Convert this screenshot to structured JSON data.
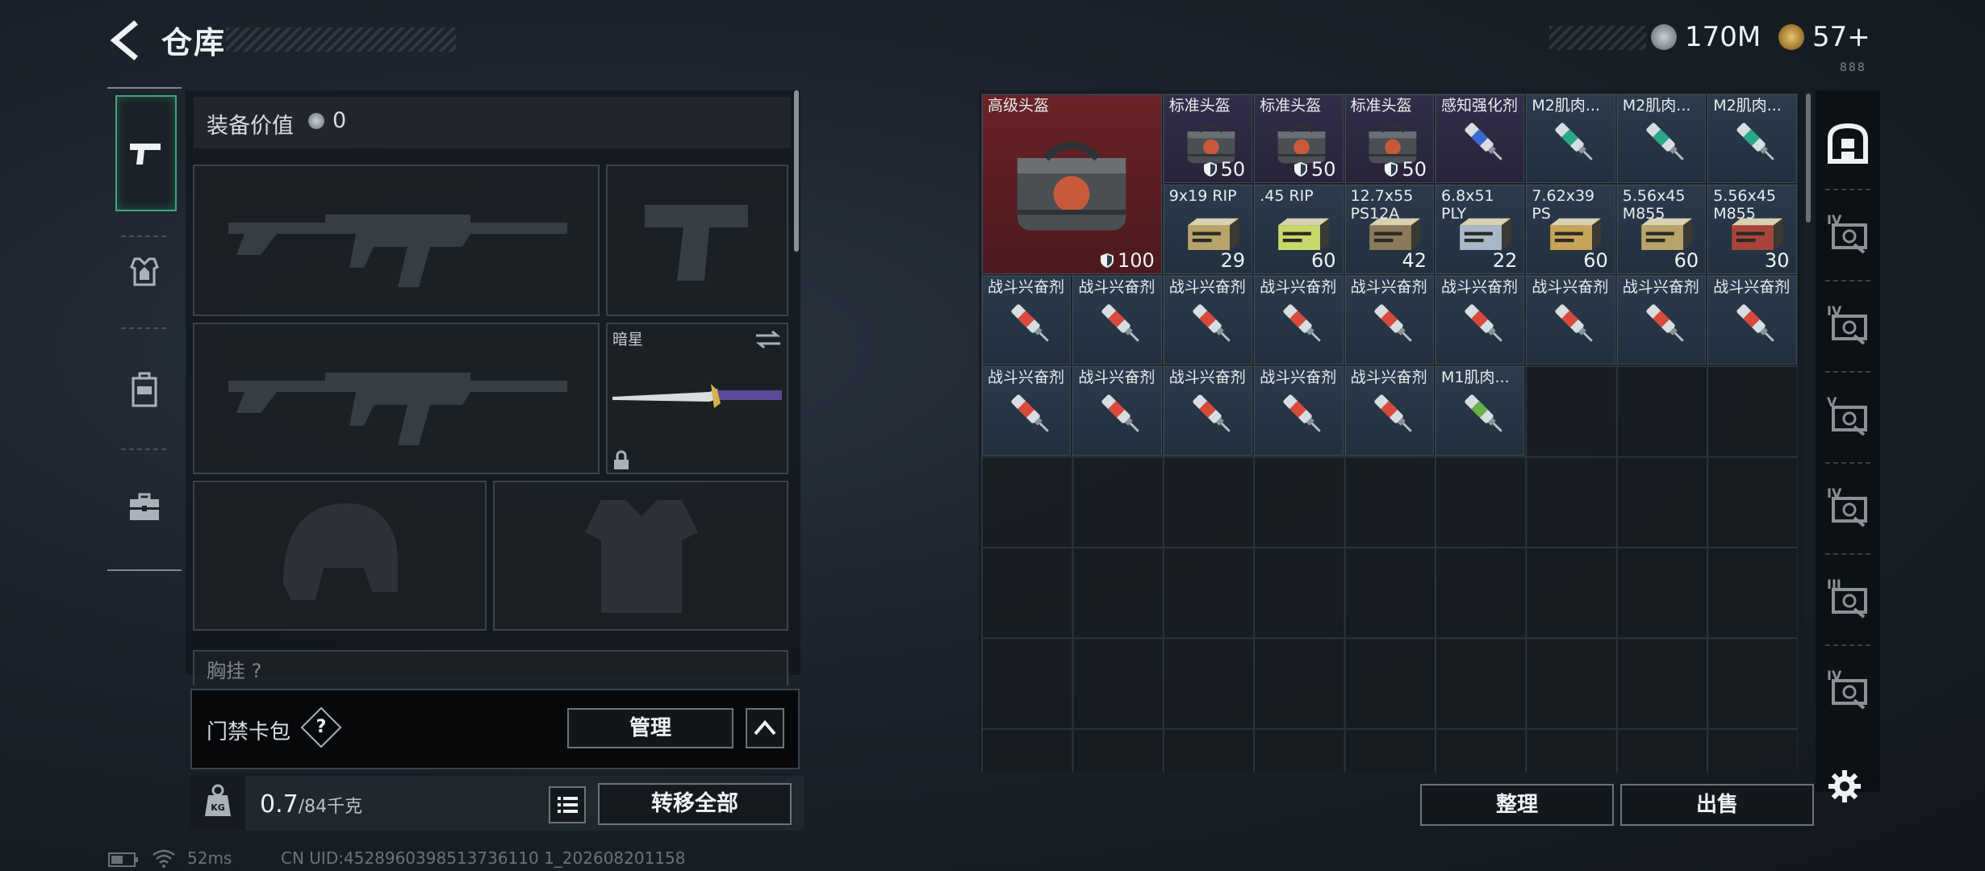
{
  "header": {
    "title": "仓库"
  },
  "currency": {
    "primary": "170M",
    "secondary": "57+",
    "sub": "888"
  },
  "sidebar": {
    "tabs": [
      {
        "name": "weapon-tab",
        "icon": "pistol-icon",
        "active": true
      },
      {
        "name": "armor-tab",
        "icon": "armor-vest-icon",
        "active": false
      },
      {
        "name": "backpack-tab",
        "icon": "backpack-icon",
        "active": false
      },
      {
        "name": "case-tab",
        "icon": "briefcase-icon",
        "active": false
      }
    ]
  },
  "equipment": {
    "value_label": "装备价值",
    "value": "0",
    "melee_slot_name": "暗星",
    "partial_label": "胸挂",
    "partial_help": "?"
  },
  "card_bag": {
    "label": "门禁卡包",
    "help": "?",
    "manage_label": "管理"
  },
  "weight": {
    "current": "0.7",
    "capacity": "/84千克"
  },
  "transfer_all_label": "转移全部",
  "storage": {
    "items": [
      {
        "name": "高级头盔",
        "count": "100",
        "shield": true,
        "rarity": "red",
        "icon": "helmet-bag-icon"
      },
      {
        "name": "标准头盔",
        "count": "50",
        "shield": true,
        "rarity": "purple",
        "icon": "helmet-bag-icon"
      },
      {
        "name": "标准头盔",
        "count": "50",
        "shield": true,
        "rarity": "purple",
        "icon": "helmet-bag-icon"
      },
      {
        "name": "标准头盔",
        "count": "50",
        "shield": true,
        "rarity": "purple",
        "icon": "helmet-bag-icon"
      },
      {
        "name": "感知强化剂",
        "count": "",
        "shield": false,
        "rarity": "purple",
        "icon": "syringe-icon"
      },
      {
        "name": "M2肌肉...",
        "count": "",
        "shield": false,
        "rarity": "blue",
        "icon": "syringe-icon"
      },
      {
        "name": "M2肌肉...",
        "count": "",
        "shield": false,
        "rarity": "blue",
        "icon": "syringe-icon"
      },
      {
        "name": "M2肌肉...",
        "count": "",
        "shield": false,
        "rarity": "blue",
        "icon": "syringe-icon"
      },
      {
        "name": "9x19 RIP",
        "count": "29",
        "shield": false,
        "rarity": "blue",
        "icon": "ammo-box-icon"
      },
      {
        "name": ".45 RIP",
        "count": "60",
        "shield": false,
        "rarity": "blue",
        "icon": "ammo-box-icon"
      },
      {
        "name": "12.7x55 PS12A",
        "count": "42",
        "shield": false,
        "rarity": "blue",
        "icon": "ammo-box-icon"
      },
      {
        "name": "6.8x51 PLY",
        "count": "22",
        "shield": false,
        "rarity": "blue",
        "icon": "ammo-box-icon"
      },
      {
        "name": "7.62x39 PS",
        "count": "60",
        "shield": false,
        "rarity": "blue",
        "icon": "ammo-box-icon"
      },
      {
        "name": "5.56x45 M855",
        "count": "60",
        "shield": false,
        "rarity": "blue",
        "icon": "ammo-box-icon"
      },
      {
        "name": "5.56x45 M855",
        "count": "30",
        "shield": false,
        "rarity": "blue",
        "icon": "ammo-box-icon"
      },
      {
        "name": "战斗兴奋剂",
        "count": "",
        "shield": false,
        "rarity": "blue",
        "icon": "syringe-icon"
      },
      {
        "name": "战斗兴奋剂",
        "count": "",
        "shield": false,
        "rarity": "blue",
        "icon": "syringe-icon"
      },
      {
        "name": "战斗兴奋剂",
        "count": "",
        "shield": false,
        "rarity": "blue",
        "icon": "syringe-icon"
      },
      {
        "name": "战斗兴奋剂",
        "count": "",
        "shield": false,
        "rarity": "blue",
        "icon": "syringe-icon"
      },
      {
        "name": "战斗兴奋剂",
        "count": "",
        "shield": false,
        "rarity": "blue",
        "icon": "syringe-icon"
      },
      {
        "name": "战斗兴奋剂",
        "count": "",
        "shield": false,
        "rarity": "blue",
        "icon": "syringe-icon"
      },
      {
        "name": "战斗兴奋剂",
        "count": "",
        "shield": false,
        "rarity": "blue",
        "icon": "syringe-icon"
      },
      {
        "name": "战斗兴奋剂",
        "count": "",
        "shield": false,
        "rarity": "blue",
        "icon": "syringe-icon"
      },
      {
        "name": "战斗兴奋剂",
        "count": "",
        "shield": false,
        "rarity": "blue",
        "icon": "syringe-icon"
      },
      {
        "name": "战斗兴奋剂",
        "count": "",
        "shield": false,
        "rarity": "blue",
        "icon": "syringe-icon"
      },
      {
        "name": "战斗兴奋剂",
        "count": "",
        "shield": false,
        "rarity": "blue",
        "icon": "syringe-icon"
      },
      {
        "name": "战斗兴奋剂",
        "count": "",
        "shield": false,
        "rarity": "blue",
        "icon": "syringe-icon"
      },
      {
        "name": "战斗兴奋剂",
        "count": "",
        "shield": false,
        "rarity": "blue",
        "icon": "syringe-icon"
      },
      {
        "name": "战斗兴奋剂",
        "count": "",
        "shield": false,
        "rarity": "blue",
        "icon": "syringe-icon"
      },
      {
        "name": "M1肌肉...",
        "count": "",
        "shield": false,
        "rarity": "blue",
        "icon": "syringe-icon"
      }
    ],
    "sort_label": "整理",
    "sell_label": "出售"
  },
  "filters": [
    {
      "name": "filter-all",
      "icon": "all-items-icon",
      "level": ""
    },
    {
      "name": "filter-lv-weapons",
      "icon": "weapon-crate-icon",
      "level": "IV"
    },
    {
      "name": "filter-lv-armor",
      "icon": "armor-icon",
      "level": "IV"
    },
    {
      "name": "filter-lv-meds",
      "icon": "medkit-icon",
      "level": "V"
    },
    {
      "name": "filter-lv-ammo",
      "icon": "ammo-icon",
      "level": "IV"
    },
    {
      "name": "filter-lv-misc",
      "icon": "warning-crate-icon",
      "level": "III"
    },
    {
      "name": "filter-lv-keys",
      "icon": "key-icon",
      "level": "IV"
    }
  ],
  "footer": {
    "ping": "52ms",
    "uid": "CN UID:4528960398513736110 1_202608201158"
  },
  "colors": {
    "accent_green": "#3fa57a",
    "rarity_red": "#6a2227",
    "rarity_purple": "#332e48",
    "rarity_blue": "#2b3b4c"
  }
}
